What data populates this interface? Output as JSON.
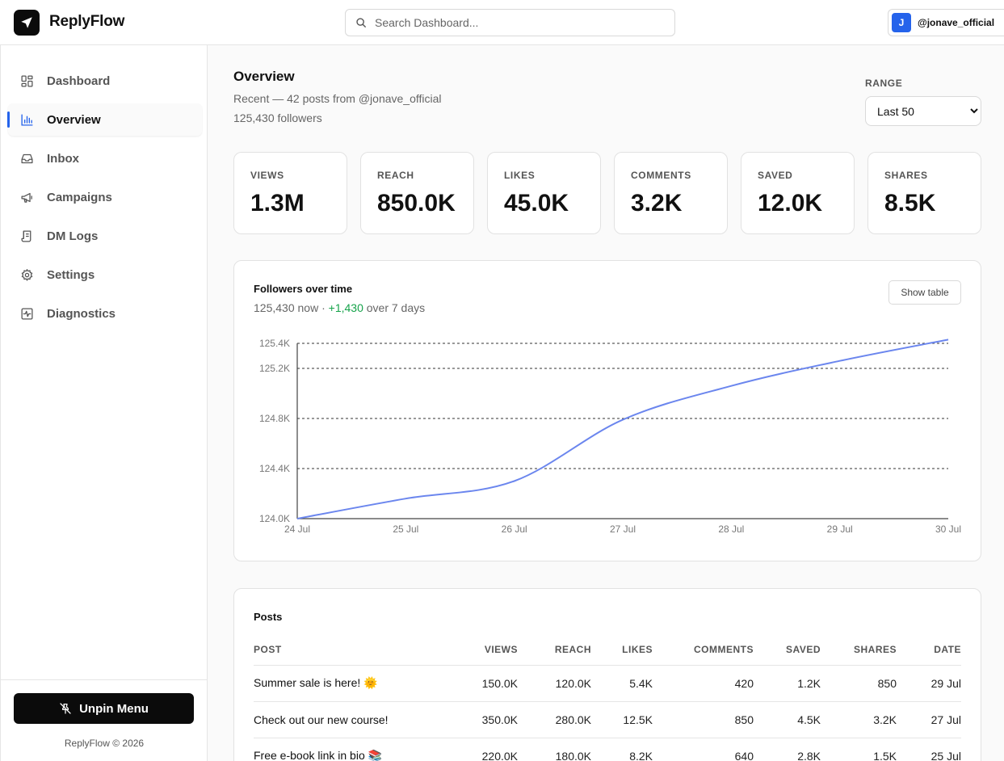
{
  "app": {
    "name": "ReplyFlow"
  },
  "search": {
    "placeholder": "Search Dashboard..."
  },
  "account": {
    "initial": "J",
    "handle": "@jonave_official"
  },
  "sidebar": {
    "items": [
      {
        "label": "Dashboard",
        "icon": "dashboard-grid-icon",
        "active": false
      },
      {
        "label": "Overview",
        "icon": "bar-chart-icon",
        "active": true
      },
      {
        "label": "Inbox",
        "icon": "inbox-icon",
        "active": false
      },
      {
        "label": "Campaigns",
        "icon": "megaphone-icon",
        "active": false
      },
      {
        "label": "DM Logs",
        "icon": "scroll-icon",
        "active": false
      },
      {
        "label": "Settings",
        "icon": "gear-icon",
        "active": false
      },
      {
        "label": "Diagnostics",
        "icon": "pulse-icon",
        "active": false
      }
    ],
    "unpin_label": "Unpin Menu",
    "copyright": "ReplyFlow © 2026"
  },
  "overview": {
    "title": "Overview",
    "subtitle": "Recent — 42 posts from @jonave_official",
    "followers_line": "125,430 followers",
    "range_label": "RANGE",
    "range_selected": "Last 50",
    "stats": [
      {
        "label": "VIEWS",
        "value": "1.3M"
      },
      {
        "label": "REACH",
        "value": "850.0K"
      },
      {
        "label": "LIKES",
        "value": "45.0K"
      },
      {
        "label": "COMMENTS",
        "value": "3.2K"
      },
      {
        "label": "SAVED",
        "value": "12.0K"
      },
      {
        "label": "SHARES",
        "value": "8.5K"
      }
    ]
  },
  "followers_chart": {
    "title": "Followers over time",
    "now_text": "125,430 now",
    "separator": " · ",
    "delta_text": "+1,430",
    "period_text": " over 7 days",
    "show_table_label": "Show table",
    "line_color": "#6b86ee",
    "delta_color": "#16a34a"
  },
  "chart_data": {
    "type": "line",
    "title": "Followers over time",
    "xlabel": "",
    "ylabel": "",
    "x": [
      "24 Jul",
      "25 Jul",
      "26 Jul",
      "27 Jul",
      "28 Jul",
      "29 Jul",
      "30 Jul"
    ],
    "series": [
      {
        "values": [
          124000,
          124160,
          124300,
          124790,
          125060,
          125260,
          125430
        ]
      }
    ],
    "y_ticks": [
      "124.0K",
      "124.4K",
      "124.8K",
      "125.2K",
      "125.4K"
    ],
    "y_tick_values": [
      124000,
      124400,
      124800,
      125200,
      125400
    ],
    "ylim": [
      124000,
      125400
    ],
    "grid": true
  },
  "posts": {
    "title": "Posts",
    "columns": [
      "POST",
      "VIEWS",
      "REACH",
      "LIKES",
      "COMMENTS",
      "SAVED",
      "SHARES",
      "DATE"
    ],
    "rows": [
      [
        "Summer sale is here! 🌞",
        "150.0K",
        "120.0K",
        "5.4K",
        "420",
        "1.2K",
        "850",
        "29 Jul"
      ],
      [
        "Check out our new course!",
        "350.0K",
        "280.0K",
        "12.5K",
        "850",
        "4.5K",
        "3.2K",
        "27 Jul"
      ],
      [
        "Free e-book link in bio 📚",
        "220.0K",
        "180.0K",
        "8.2K",
        "640",
        "2.8K",
        "1.5K",
        "25 Jul"
      ]
    ]
  }
}
